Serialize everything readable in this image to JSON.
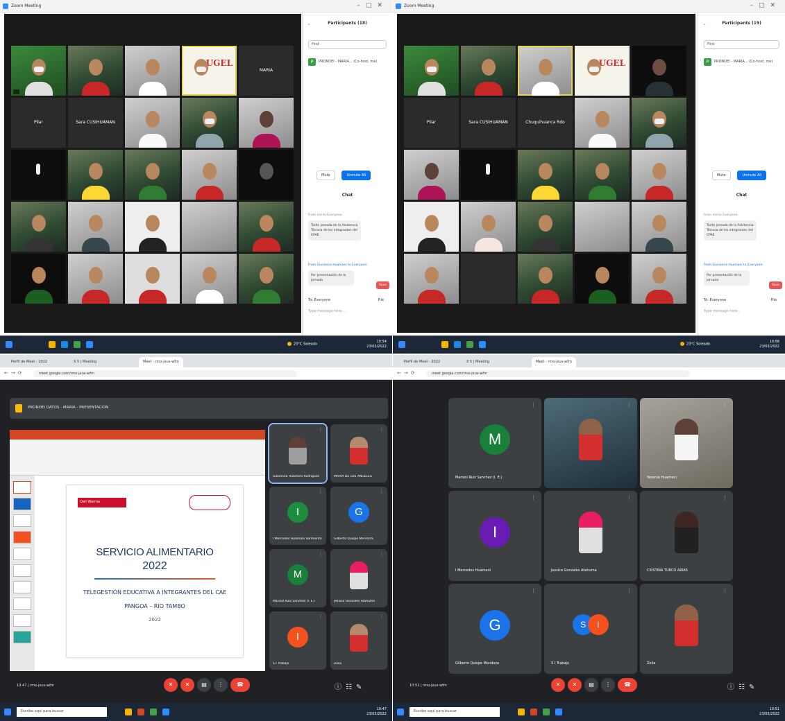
{
  "zoom_a": {
    "window_title": "Zoom Meeting",
    "panel_title": "Participants (18)",
    "search_placeholder": "Find",
    "participant_row": "PRONOEI - MARIA...  (Co-host, me)",
    "participant_initial": "P",
    "mute_all_label": "Mute",
    "unmute_label": "Unmute All",
    "chat_title": "Chat",
    "chat_from": "From me to Everyone:",
    "chat_message": "Tarde jornada de la Asistencia Técnica de los integrantes del CPAE",
    "chat_from_2": "From Giovanna Huamaní to Everyone:",
    "chat_message_2": "Por presentación de la jornada",
    "save_label": "Save",
    "to_label": "To: Everyone",
    "file_label": "File",
    "type_placeholder": "Type message here...",
    "tiles_row1": [
      "",
      "",
      "",
      "",
      "MARIA"
    ],
    "tiles_row2": [
      "Pilar",
      "Sara CUSIHUAMAN",
      "",
      "",
      ""
    ],
    "temperature": "23°C Soleado",
    "clock": "10:54\n23/03/2022",
    "ugel_logo": "UGEL"
  },
  "zoom_b": {
    "window_title": "Zoom Meeting",
    "panel_title": "Participants (19)",
    "search_placeholder": "Find",
    "participant_row": "PRONOEI - MARIA...  (Co-host, me)",
    "participant_initial": "P",
    "mute_all_label": "Mute",
    "unmute_label": "Unmute All",
    "chat_title": "Chat",
    "chat_from": "From me to Everyone:",
    "chat_message": "Tarde jornada de la Asistencia Técnica de los integrantes del CPAE",
    "chat_from_2": "From Giovanna Huamaní to Everyone:",
    "chat_message_2": "Por presentación de la jornada",
    "save_label": "Save",
    "to_label": "To: Everyone",
    "file_label": "File",
    "type_placeholder": "Type message here...",
    "tiles_row2": [
      "Pilar",
      "Sara CUSIHUAMAN",
      "Chuquihuanca Rdo"
    ],
    "temperature": "23°C Soleado",
    "clock": "10:58\n23/03/2022",
    "ugel_logo": "UGEL"
  },
  "meet_a": {
    "tabs": [
      "Perfil de Meet - 2022",
      "X 5 | Meeting",
      "Meet - rmo-jxus-wfm"
    ],
    "url": "meet.google.com/rmo-jxus-wfm",
    "presenting_label": "PRONOEI DATOS - MARIA - PRESENTACION",
    "slide_title_1": "SERVICIO ALIMENTARIO",
    "slide_title_2": "2022",
    "slide_sub_1": "TELEGESTIÓN EDUCATIVA A INTEGRANTES DEL CAE",
    "slide_sub_2": "PANGOA – RIO TAMBO",
    "slide_sub_3": "2022",
    "brand_label": "Qali Warma",
    "tiles": [
      {
        "name": "Giovanna Huamani Rodriguez",
        "initial": "",
        "color": ""
      },
      {
        "name": "MARIA DE LOS ANGELES",
        "initial": "",
        "color": ""
      },
      {
        "name": "I Mercedes Huamani Sarmiento",
        "initial": "I",
        "color": "#1e8e3e"
      },
      {
        "name": "Gilberto Quispe Mendoza",
        "initial": "G",
        "color": "#1a73e8"
      },
      {
        "name": "Marisol Ruiz Sanchez (I. E.)",
        "initial": "M",
        "color": "#188038"
      },
      {
        "name": "Jessica Gonzales Atahuma",
        "initial": "",
        "color": ""
      },
      {
        "name": "S I Trabajo",
        "initial": "I",
        "color": "#f4511e"
      },
      {
        "name": "Zoila",
        "initial": "",
        "color": ""
      }
    ],
    "meeting_info": "10:47 | rmo-jxus-wfm",
    "search_task": "Escribe aquí para buscar",
    "clock": "10:47\n23/03/2022"
  },
  "meet_b": {
    "tabs": [
      "Perfil de Meet - 2022",
      "X 5 | Meeting",
      "Meet - rmo-jxus-wfm"
    ],
    "url": "meet.google.com/rmo-jxus-wfm",
    "tiles": [
      {
        "name": "Marisol Ruiz Sanchez (I. E.)",
        "initial": "M",
        "color": "#188038"
      },
      {
        "name": "",
        "initial": "",
        "color": ""
      },
      {
        "name": "Yesenia Huamani",
        "initial": "",
        "color": ""
      },
      {
        "name": "I Mercedes Huamani",
        "initial": "I",
        "color": "#6a1bb3"
      },
      {
        "name": "Jessica Gonzales Atahuma",
        "initial": "",
        "color": ""
      },
      {
        "name": "CRISTINA TURCO ARIAS",
        "initial": "",
        "color": ""
      },
      {
        "name": "Gilberto Quispe Mendoza",
        "initial": "G",
        "color": "#1a73e8"
      },
      {
        "name": "S I Trabajo",
        "initial": "S I",
        "color": "#1a73e8"
      },
      {
        "name": "Zoila",
        "initial": "",
        "color": ""
      }
    ],
    "meeting_info": "10:51 | rmo-jxus-wfm",
    "search_task": "Escribe aquí para buscar",
    "clock": "10:51\n23/03/2022"
  }
}
